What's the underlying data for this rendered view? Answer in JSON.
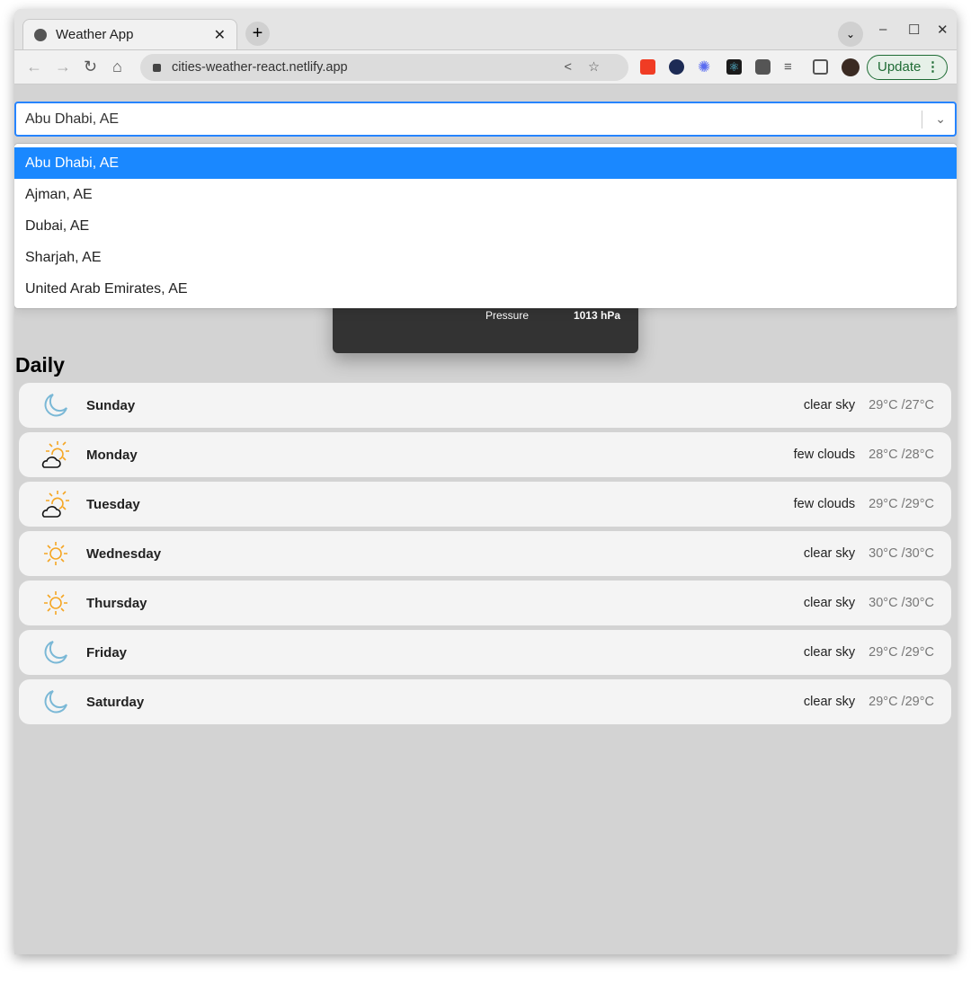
{
  "browser": {
    "tab_title": "Weather App",
    "url": "cities-weather-react.netlify.app",
    "update_label": "Update"
  },
  "search": {
    "selected": "Abu Dhabi, AE",
    "options": [
      "Abu Dhabi, AE",
      "Ajman, AE",
      "Dubai, AE",
      "Sharjah, AE",
      "United Arab Emirates, AE"
    ]
  },
  "current": {
    "pressure_label": "Pressure",
    "pressure_value": "1013 hPa"
  },
  "daily": {
    "title": "Daily",
    "days": [
      {
        "day": "Sunday",
        "desc": "clear sky",
        "temp": "29°C /27°C",
        "icon": "moon-icon"
      },
      {
        "day": "Monday",
        "desc": "few clouds",
        "temp": "28°C /28°C",
        "icon": "sun-cloud-icon"
      },
      {
        "day": "Tuesday",
        "desc": "few clouds",
        "temp": "29°C /29°C",
        "icon": "sun-cloud-icon"
      },
      {
        "day": "Wednesday",
        "desc": "clear sky",
        "temp": "30°C /30°C",
        "icon": "sun-icon"
      },
      {
        "day": "Thursday",
        "desc": "clear sky",
        "temp": "30°C /30°C",
        "icon": "sun-icon"
      },
      {
        "day": "Friday",
        "desc": "clear sky",
        "temp": "29°C /29°C",
        "icon": "moon-icon"
      },
      {
        "day": "Saturday",
        "desc": "clear sky",
        "temp": "29°C /29°C",
        "icon": "moon-icon"
      }
    ]
  },
  "colors": {
    "accent": "#2684ff",
    "selected_option": "#1a88ff",
    "card": "#333333",
    "sun": "#f5a623",
    "moon": "#7ab8d6"
  }
}
